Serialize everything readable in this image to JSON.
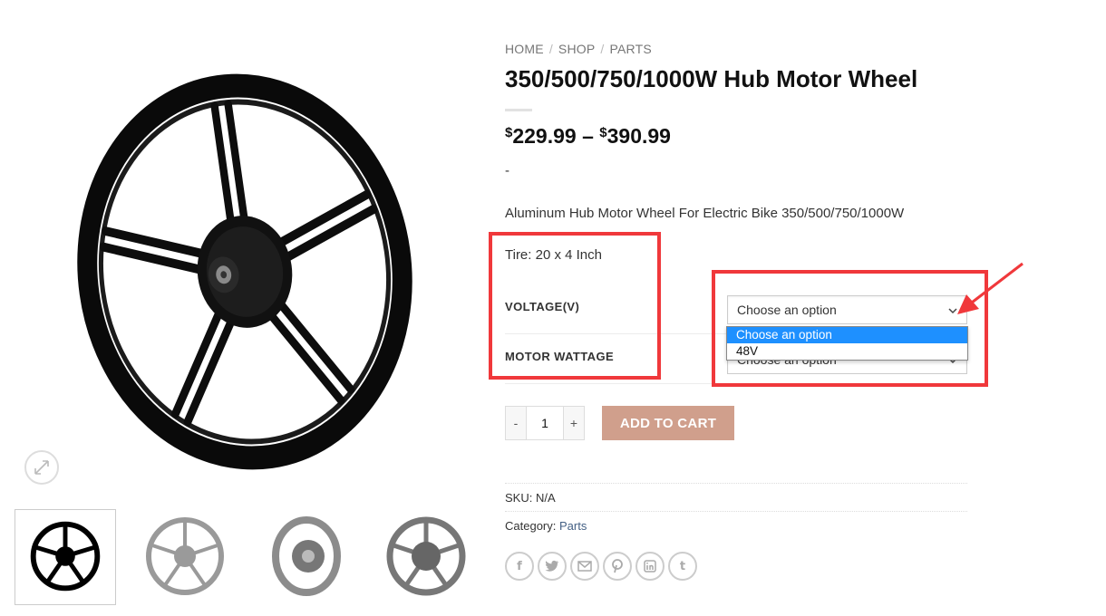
{
  "breadcrumb": {
    "home": "HOME",
    "shop": "SHOP",
    "parts": "PARTS",
    "sep": "/"
  },
  "product": {
    "title": "350/500/750/1000W Hub Motor Wheel",
    "price_currency": "$",
    "price_min": "229.99",
    "price_sep": "–",
    "price_max": "390.99",
    "dash": "-",
    "short_desc": "Aluminum Hub Motor Wheel For Electric Bike 350/500/750/1000W",
    "tire": "Tire: 20 x 4 Inch"
  },
  "variations": {
    "voltage_label": "VOLTAGE(V)",
    "voltage_value": "Choose an option",
    "wattage_label": "MOTOR WATTAGE",
    "wattage_value": "Choose an option",
    "dropdown_options": [
      "Choose an option",
      "48V"
    ],
    "dropdown_selected_index": 0
  },
  "cart": {
    "minus": "-",
    "quantity": "1",
    "plus": "+",
    "add_to_cart": "ADD TO CART"
  },
  "meta": {
    "sku_label": "SKU:",
    "sku_value": "N/A",
    "category_label": "Category:",
    "category_value": "Parts"
  },
  "share_icons": [
    "facebook-icon",
    "twitter-icon",
    "email-icon",
    "pinterest-icon",
    "linkedin-icon",
    "tumblr-icon"
  ],
  "colors": {
    "cart_button": "#d09f8c",
    "annotation_red": "#f0383b",
    "dropdown_highlight": "#1e90ff",
    "category_link": "#446084"
  }
}
